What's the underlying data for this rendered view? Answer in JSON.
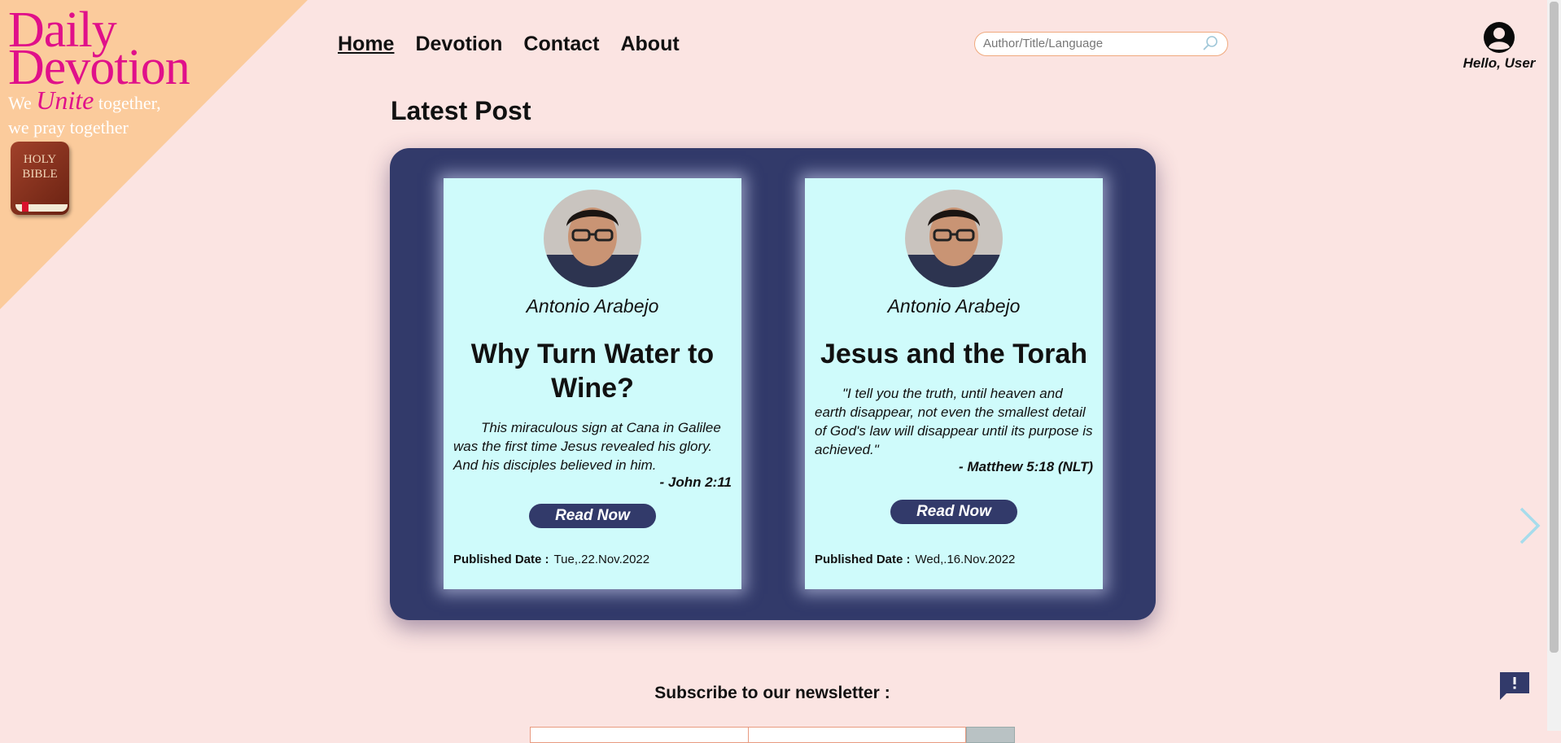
{
  "brand": {
    "logo_line1": "Daily",
    "logo_line2": "Devotion",
    "tagline_we": "We",
    "tagline_unite": "Unite",
    "tagline_together": "together,",
    "tagline_line2": "we pray together",
    "bible_label": "HOLY BIBLE"
  },
  "nav": {
    "items": [
      {
        "label": "Home",
        "active": true
      },
      {
        "label": "Devotion",
        "active": false
      },
      {
        "label": "Contact",
        "active": false
      },
      {
        "label": "About",
        "active": false
      }
    ]
  },
  "search": {
    "placeholder": "Author/Title/Language",
    "icon": "search-icon"
  },
  "user": {
    "greeting": "Hello, User",
    "icon": "user-avatar-icon"
  },
  "section_title": "Latest Post",
  "posts": [
    {
      "author": "Antonio Arabejo",
      "title": "Why Turn Water to Wine?",
      "excerpt": "This miraculous sign at Cana in Galilee was the first time Jesus revealed his glory. And his disciples believed in him.",
      "reference": "- John 2:11",
      "button": "Read Now",
      "published_label": "Published Date :",
      "published_date": "Tue,.22.Nov.2022"
    },
    {
      "author": "Antonio Arabejo",
      "title": "Jesus and the Torah",
      "excerpt": "\"I tell you the truth, until heaven and earth disappear, not even the smallest detail of God's law will disappear until its purpose is achieved.\"",
      "reference": "- Matthew 5:18 (NLT)",
      "button": "Read Now",
      "published_label": "Published Date :",
      "published_date": "Wed,.16.Nov.2022"
    }
  ],
  "newsletter": {
    "title": "Subscribe to our newsletter :"
  },
  "colors": {
    "background": "#fbe4e2",
    "corner": "#fbcb9c",
    "brand_pink": "#e0108a",
    "carousel_bg": "#323a6a",
    "card_bg": "#cffbfb"
  }
}
